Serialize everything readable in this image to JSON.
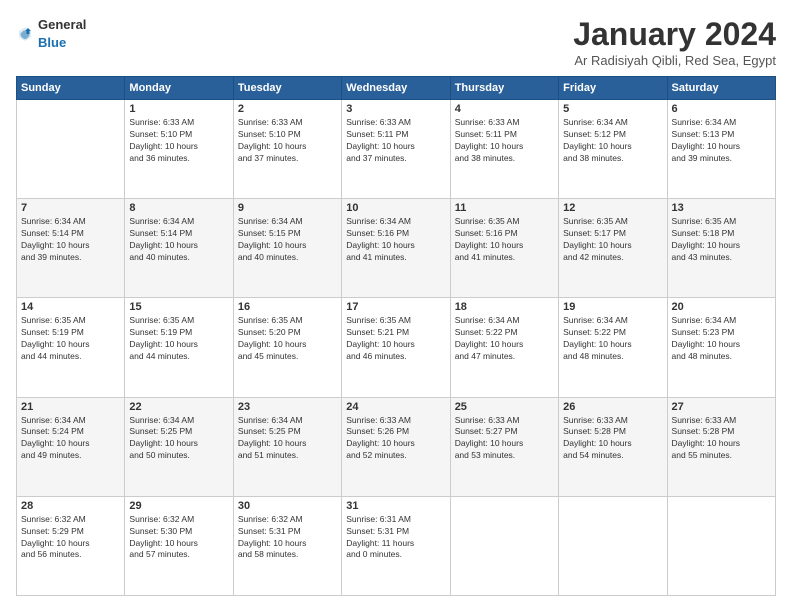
{
  "header": {
    "logo_general": "General",
    "logo_blue": "Blue",
    "title": "January 2024",
    "subtitle": "Ar Radisiyah Qibli, Red Sea, Egypt"
  },
  "columns": [
    "Sunday",
    "Monday",
    "Tuesday",
    "Wednesday",
    "Thursday",
    "Friday",
    "Saturday"
  ],
  "weeks": [
    [
      {
        "day": "",
        "info": ""
      },
      {
        "day": "1",
        "info": "Sunrise: 6:33 AM\nSunset: 5:10 PM\nDaylight: 10 hours\nand 36 minutes."
      },
      {
        "day": "2",
        "info": "Sunrise: 6:33 AM\nSunset: 5:10 PM\nDaylight: 10 hours\nand 37 minutes."
      },
      {
        "day": "3",
        "info": "Sunrise: 6:33 AM\nSunset: 5:11 PM\nDaylight: 10 hours\nand 37 minutes."
      },
      {
        "day": "4",
        "info": "Sunrise: 6:33 AM\nSunset: 5:11 PM\nDaylight: 10 hours\nand 38 minutes."
      },
      {
        "day": "5",
        "info": "Sunrise: 6:34 AM\nSunset: 5:12 PM\nDaylight: 10 hours\nand 38 minutes."
      },
      {
        "day": "6",
        "info": "Sunrise: 6:34 AM\nSunset: 5:13 PM\nDaylight: 10 hours\nand 39 minutes."
      }
    ],
    [
      {
        "day": "7",
        "info": "Sunrise: 6:34 AM\nSunset: 5:14 PM\nDaylight: 10 hours\nand 39 minutes."
      },
      {
        "day": "8",
        "info": "Sunrise: 6:34 AM\nSunset: 5:14 PM\nDaylight: 10 hours\nand 40 minutes."
      },
      {
        "day": "9",
        "info": "Sunrise: 6:34 AM\nSunset: 5:15 PM\nDaylight: 10 hours\nand 40 minutes."
      },
      {
        "day": "10",
        "info": "Sunrise: 6:34 AM\nSunset: 5:16 PM\nDaylight: 10 hours\nand 41 minutes."
      },
      {
        "day": "11",
        "info": "Sunrise: 6:35 AM\nSunset: 5:16 PM\nDaylight: 10 hours\nand 41 minutes."
      },
      {
        "day": "12",
        "info": "Sunrise: 6:35 AM\nSunset: 5:17 PM\nDaylight: 10 hours\nand 42 minutes."
      },
      {
        "day": "13",
        "info": "Sunrise: 6:35 AM\nSunset: 5:18 PM\nDaylight: 10 hours\nand 43 minutes."
      }
    ],
    [
      {
        "day": "14",
        "info": "Sunrise: 6:35 AM\nSunset: 5:19 PM\nDaylight: 10 hours\nand 44 minutes."
      },
      {
        "day": "15",
        "info": "Sunrise: 6:35 AM\nSunset: 5:19 PM\nDaylight: 10 hours\nand 44 minutes."
      },
      {
        "day": "16",
        "info": "Sunrise: 6:35 AM\nSunset: 5:20 PM\nDaylight: 10 hours\nand 45 minutes."
      },
      {
        "day": "17",
        "info": "Sunrise: 6:35 AM\nSunset: 5:21 PM\nDaylight: 10 hours\nand 46 minutes."
      },
      {
        "day": "18",
        "info": "Sunrise: 6:34 AM\nSunset: 5:22 PM\nDaylight: 10 hours\nand 47 minutes."
      },
      {
        "day": "19",
        "info": "Sunrise: 6:34 AM\nSunset: 5:22 PM\nDaylight: 10 hours\nand 48 minutes."
      },
      {
        "day": "20",
        "info": "Sunrise: 6:34 AM\nSunset: 5:23 PM\nDaylight: 10 hours\nand 48 minutes."
      }
    ],
    [
      {
        "day": "21",
        "info": "Sunrise: 6:34 AM\nSunset: 5:24 PM\nDaylight: 10 hours\nand 49 minutes."
      },
      {
        "day": "22",
        "info": "Sunrise: 6:34 AM\nSunset: 5:25 PM\nDaylight: 10 hours\nand 50 minutes."
      },
      {
        "day": "23",
        "info": "Sunrise: 6:34 AM\nSunset: 5:25 PM\nDaylight: 10 hours\nand 51 minutes."
      },
      {
        "day": "24",
        "info": "Sunrise: 6:33 AM\nSunset: 5:26 PM\nDaylight: 10 hours\nand 52 minutes."
      },
      {
        "day": "25",
        "info": "Sunrise: 6:33 AM\nSunset: 5:27 PM\nDaylight: 10 hours\nand 53 minutes."
      },
      {
        "day": "26",
        "info": "Sunrise: 6:33 AM\nSunset: 5:28 PM\nDaylight: 10 hours\nand 54 minutes."
      },
      {
        "day": "27",
        "info": "Sunrise: 6:33 AM\nSunset: 5:28 PM\nDaylight: 10 hours\nand 55 minutes."
      }
    ],
    [
      {
        "day": "28",
        "info": "Sunrise: 6:32 AM\nSunset: 5:29 PM\nDaylight: 10 hours\nand 56 minutes."
      },
      {
        "day": "29",
        "info": "Sunrise: 6:32 AM\nSunset: 5:30 PM\nDaylight: 10 hours\nand 57 minutes."
      },
      {
        "day": "30",
        "info": "Sunrise: 6:32 AM\nSunset: 5:31 PM\nDaylight: 10 hours\nand 58 minutes."
      },
      {
        "day": "31",
        "info": "Sunrise: 6:31 AM\nSunset: 5:31 PM\nDaylight: 11 hours\nand 0 minutes."
      },
      {
        "day": "",
        "info": ""
      },
      {
        "day": "",
        "info": ""
      },
      {
        "day": "",
        "info": ""
      }
    ]
  ]
}
